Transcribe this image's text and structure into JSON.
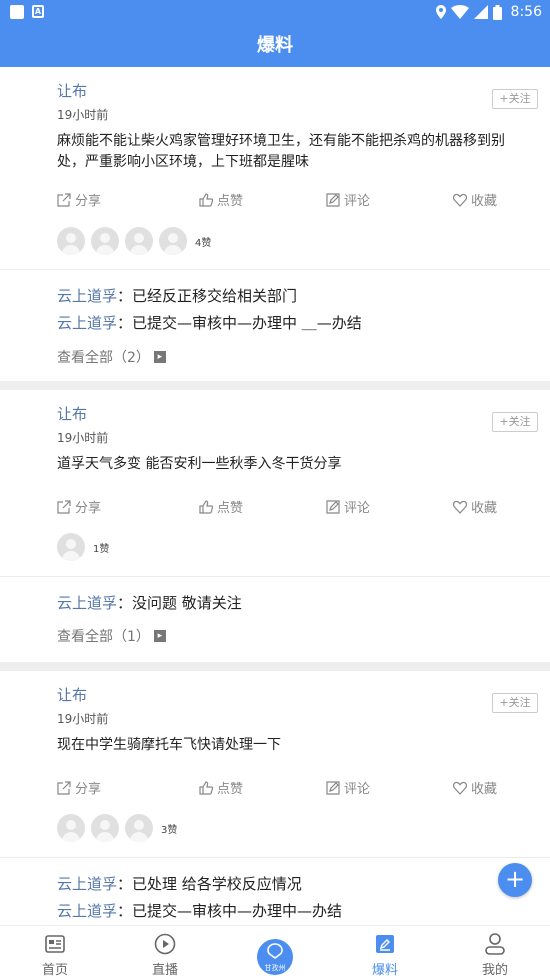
{
  "status_bar": {
    "time": "8:56"
  },
  "header": {
    "title": "爆料"
  },
  "posts": [
    {
      "author": "让布",
      "time": "19小时前",
      "follow_label": "+关注",
      "content": "麻烦能不能让柴火鸡家管理好环境卫生，还有能不能把杀鸡的机器移到别处，严重影响小区环境，上下班都是腥味",
      "actions": {
        "share": "分享",
        "like": "点赞",
        "comment": "评论",
        "favorite": "收藏"
      },
      "avatar_count": 4,
      "likes_text": "4赞",
      "replies": [
        {
          "name": "云上道孚",
          "text": "已经反正移交给相关部门"
        },
        {
          "name": "云上道孚",
          "text": "已提交—审核中—办理中 ＿—办结"
        }
      ],
      "view_all": "查看全部（2）"
    },
    {
      "author": "让布",
      "time": "19小时前",
      "follow_label": "+关注",
      "content": "道孚天气多变  能否安利一些秋季入冬干货分享",
      "actions": {
        "share": "分享",
        "like": "点赞",
        "comment": "评论",
        "favorite": "收藏"
      },
      "avatar_count": 1,
      "likes_text": "1赞",
      "replies": [
        {
          "name": "云上道孚",
          "text": "没问题  敬请关注"
        }
      ],
      "view_all": "查看全部（1）"
    },
    {
      "author": "让布",
      "time": "19小时前",
      "follow_label": "+关注",
      "content": "现在中学生骑摩托车飞快请处理一下",
      "actions": {
        "share": "分享",
        "like": "点赞",
        "comment": "评论",
        "favorite": "收藏"
      },
      "avatar_count": 3,
      "likes_text": "3赞",
      "replies": [
        {
          "name": "云上道孚",
          "text": "已处理  给各学校反应情况"
        },
        {
          "name": "云上道孚",
          "text": "已提交—审核中—办理中—办结"
        }
      ]
    }
  ],
  "fab": {
    "label": "+"
  },
  "tabbar": {
    "items": [
      {
        "label": "首页",
        "icon": "home-news-icon"
      },
      {
        "label": "直播",
        "icon": "play-icon"
      },
      {
        "label": "甘孜州",
        "icon": "center-logo-icon"
      },
      {
        "label": "爆料",
        "icon": "edit-icon",
        "active": true
      },
      {
        "label": "我的",
        "icon": "user-icon"
      }
    ]
  },
  "colors": {
    "primary": "#4b8ef0",
    "name_blue": "#5577aa"
  }
}
